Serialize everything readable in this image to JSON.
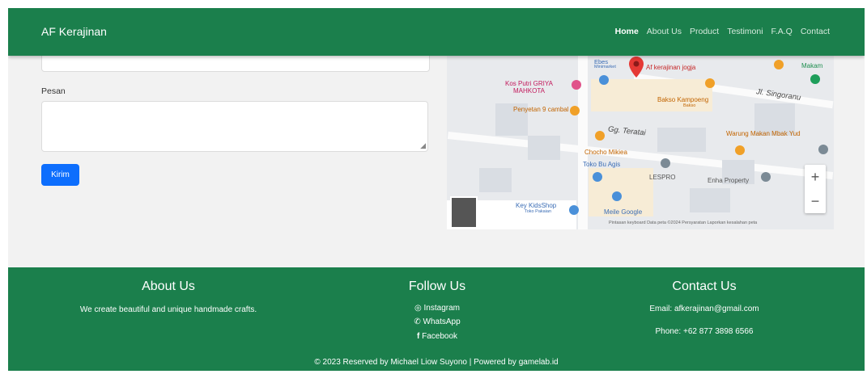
{
  "navbar": {
    "brand": "AF Kerajinan",
    "links": [
      "Home",
      "About Us",
      "Product",
      "Testimoni",
      "F.A.Q",
      "Contact"
    ],
    "active": "Home"
  },
  "form": {
    "pesan_label": "Pesan",
    "submit_label": "Kirim"
  },
  "map": {
    "pin_label": "Af kerajinan jogja",
    "labels": {
      "ebes": "Ebes",
      "ebes_sub": "Minimarket",
      "kos_putri": "Kos Putri GRIYA\nMAHKOTA",
      "penyetan": "Penyetan 9 cambal",
      "bakso": "Bakso Kampoeng",
      "bakso_sub": "Bakso",
      "makam": "Makam",
      "street1": "Jl. Singoranu",
      "street2": "Gg. Teratai",
      "warung": "Warung Makan Mbak Yud",
      "chocho": "Chocho Mikiea",
      "toko_bu": "Toko Bu Agis",
      "lespro": "LESPRO",
      "enha": "Enha Property",
      "key_kids": "Key KidsShop",
      "key_kids_sub": "Toko Pakaian",
      "meile": "Meile Google"
    },
    "footer_text": "Pintasan keyboard   Data peta ©2024   Persyaratan   Laporkan kesalahan peta",
    "zoom_in": "+",
    "zoom_out": "−"
  },
  "footer": {
    "about": {
      "title": "About Us",
      "text": "We create beautiful and unique handmade crafts."
    },
    "follow": {
      "title": "Follow Us",
      "instagram": "Instagram",
      "whatsapp": "WhatsApp",
      "facebook": "Facebook"
    },
    "contact": {
      "title": "Contact Us",
      "email": "Email: afkerajinan@gmail.com",
      "phone": "Phone: +62 877 3898 6566"
    },
    "copyright": "© 2023 Reserved by Michael Liow Suyono | Powered by gamelab.id"
  },
  "colors": {
    "brand_green": "#1b7f4c",
    "button_blue": "#0d6efd",
    "map_pin_red": "#e53935"
  }
}
